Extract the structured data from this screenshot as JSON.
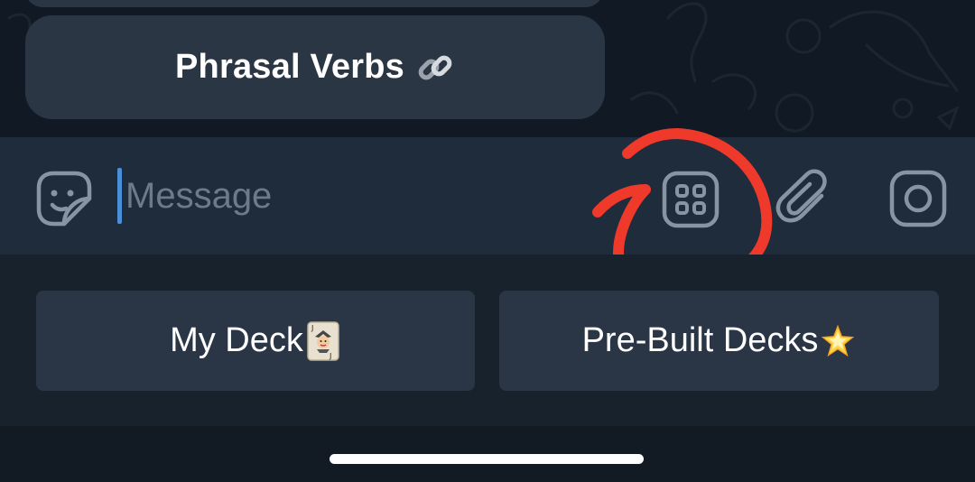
{
  "chat": {
    "inline_button_label": "Phrasal Verbs",
    "inline_button_icon": "link-icon"
  },
  "input": {
    "placeholder": "Message",
    "left_icon": "sticker-icon",
    "right_icons": [
      "apps-grid-icon",
      "paperclip-icon",
      "camera-icon"
    ]
  },
  "annotation": {
    "color": "#ef3a2b",
    "shape": "red hand-drawn circle around apps-grid-icon"
  },
  "keyboard": {
    "buttons": [
      {
        "label": "My Deck",
        "icon": "joker-card-icon"
      },
      {
        "label": "Pre-Built Decks",
        "icon": "glowing-star-icon"
      }
    ]
  },
  "colors": {
    "background": "#18222d",
    "input_bar": "#1e2c3b",
    "button": "#2a3546",
    "icon": "#8795a3",
    "caret": "#4a90d9",
    "placeholder": "#6c7a89"
  }
}
